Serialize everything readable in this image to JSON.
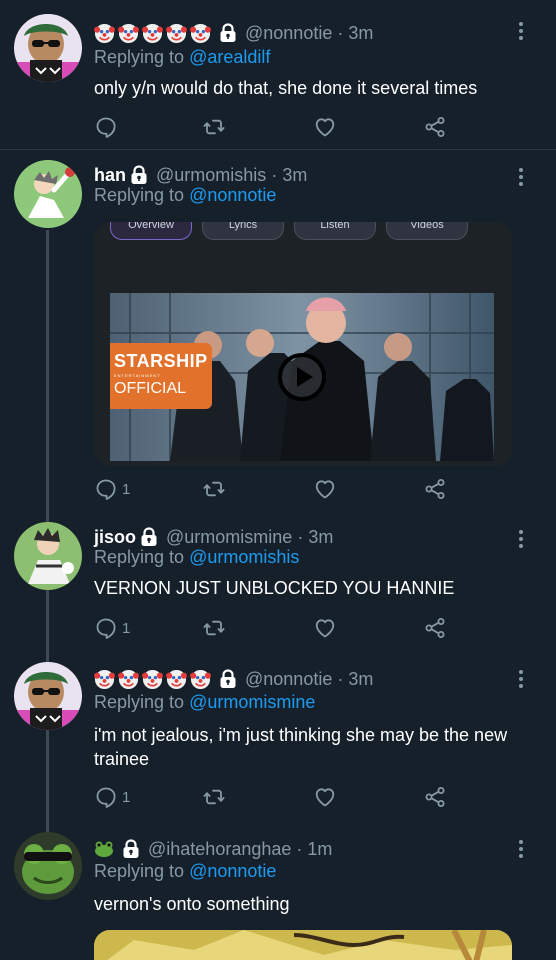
{
  "tweets": [
    {
      "handle": "@nonnotie",
      "sep": "·",
      "time": "3m",
      "replying_prefix": "Replying to",
      "replying_to": "@arealdilf",
      "text": "only y/n would do that, she done it several times"
    },
    {
      "name": "han",
      "handle": "@urmomishis",
      "sep": "·",
      "time": "3m",
      "replying_prefix": "Replying to",
      "replying_to": "@nonnotie",
      "reply_count": "1",
      "media": {
        "tabs": [
          "Overview",
          "Lyrics",
          "Listen",
          "Videos"
        ],
        "logo_line1": "STARSHIP",
        "logo_line2": "ENTERTAINMENT",
        "logo_line3": "OFFICIAL"
      }
    },
    {
      "name": "jisoo",
      "handle": "@urmomismine",
      "sep": "·",
      "time": "3m",
      "replying_prefix": "Replying to",
      "replying_to": "@urmomishis",
      "text": "VERNON JUST UNBLOCKED YOU HANNIE",
      "reply_count": "1"
    },
    {
      "handle": "@nonnotie",
      "sep": "·",
      "time": "3m",
      "replying_prefix": "Replying to",
      "replying_to": "@urmomismine",
      "text": "i'm not jealous, i'm just thinking she may be the new trainee",
      "reply_count": "1"
    },
    {
      "handle": "@ihatehoranghae",
      "sep": "·",
      "time": "1m",
      "replying_prefix": "Replying to",
      "replying_to": "@nonnotie",
      "text": "vernon's onto something"
    }
  ],
  "icons": {
    "reply": "reply-icon",
    "retweet": "retweet-icon",
    "like": "heart-icon",
    "share": "share-icon",
    "more": "more-icon",
    "lock": "lock-icon",
    "clown": "clown-emoji-icon",
    "frog": "frog-emoji-icon"
  },
  "colors": {
    "background": "#15202b",
    "muted": "#8899a6",
    "link": "#1d9bf0",
    "starship_orange": "#e2712b"
  }
}
